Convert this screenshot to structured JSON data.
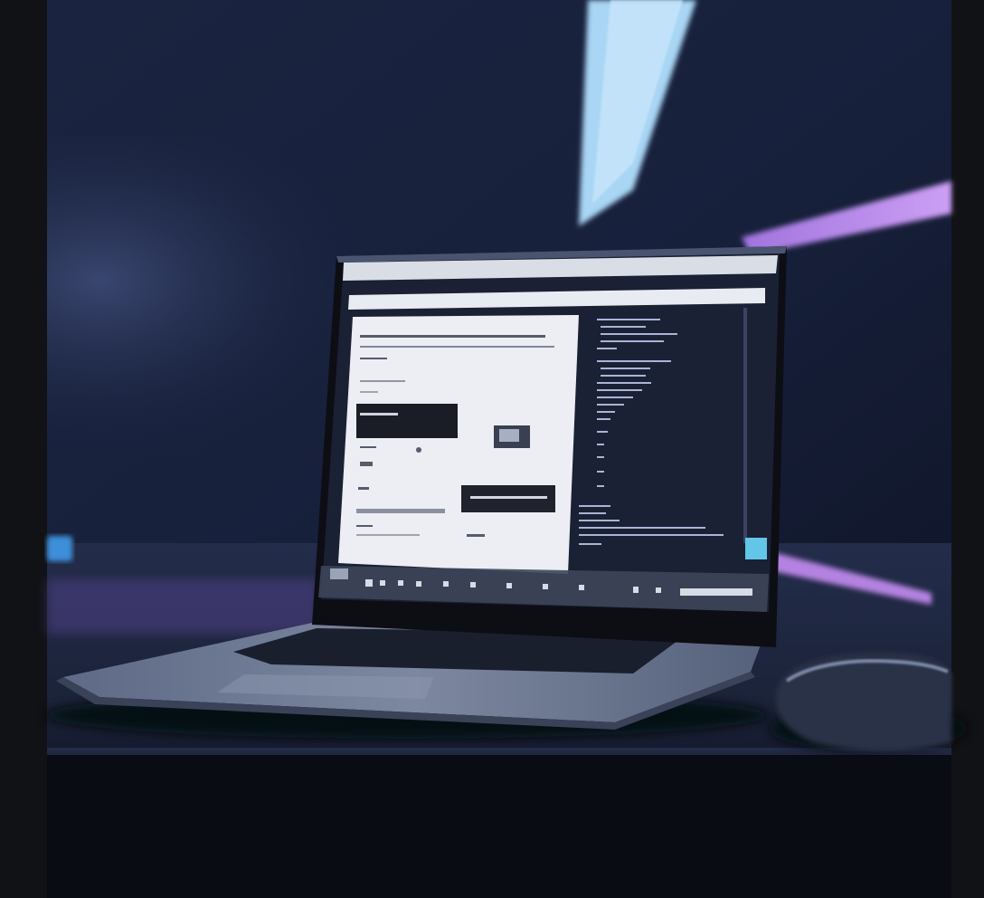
{
  "scene": {
    "palette": {
      "frame_bar": "#111215",
      "wall_dark": "#141c33",
      "wall_mid": "#1f2a4a",
      "light_blue": "#a9d6f4",
      "light_violet": "#c48cf2",
      "desk_top": "#2a3352",
      "desk_edge": "#0a0c14",
      "laptop_body": "#6b7487",
      "bezel": "#0c0e14",
      "editor_bg": "#1a2134",
      "code_text": "#aab4d8",
      "document_bg": "#eceef3",
      "mouse": "#2c3346"
    },
    "icons": [
      "laptop-icon",
      "mouse-icon",
      "keyboard-icon"
    ]
  }
}
